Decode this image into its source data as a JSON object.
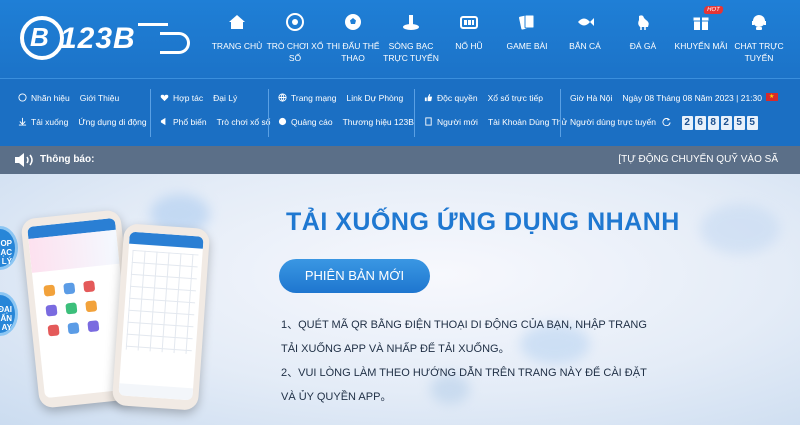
{
  "logo": {
    "text": "123B"
  },
  "nav": [
    {
      "icon": "home-icon",
      "label": "TRANG CHỦ"
    },
    {
      "icon": "lottery-icon",
      "label": "TRÒ CHƠI XỔ SỐ"
    },
    {
      "icon": "soccer-ball-icon",
      "label": "THI ĐẤU THỂ THAO"
    },
    {
      "icon": "casino-icon",
      "label": "SÒNG BẠC TRỰC TUYẾN"
    },
    {
      "icon": "slot-machine-icon",
      "label": "NỔ HŨ"
    },
    {
      "icon": "cards-icon",
      "label": "GAME BÀI"
    },
    {
      "icon": "fish-icon",
      "label": "BẮN CÁ"
    },
    {
      "icon": "rooster-icon",
      "label": "ĐÁ GÀ"
    },
    {
      "icon": "gift-icon",
      "label": "KHUYẾN MÃI",
      "badge": "HOT"
    },
    {
      "icon": "chat-icon",
      "label": "CHAT TRỰC TUYẾN"
    }
  ],
  "info": {
    "brand": "Nhãn hiệu",
    "intro": "Giới Thiệu",
    "download": "Tải xuống",
    "mobile_app": "Ứng dụng di động",
    "cooperation": "Hợp tác",
    "agent": "Đại Lý",
    "popularize": "Phổ biến",
    "lottery_game": "Trò chơi xổ số",
    "website": "Trang mạng",
    "backup_link": "Link Dự Phòng",
    "ads": "Quảng cáo",
    "brand_123b": "Thương hiệu 123B",
    "exclusive": "Độc quyền",
    "live_lottery": "Xổ số trực tiếp",
    "newcomer": "Người mới",
    "trial_account": "Tài Khoản Dùng Thử",
    "time_prefix": "Giờ Hà Nội",
    "datetime": "Ngày 08 Tháng 08 Năm 2023 | 21:30",
    "online_users": "Người dùng trực tuyến",
    "counter": [
      "2",
      "6",
      "8",
      "2",
      "5",
      "5"
    ]
  },
  "notice": {
    "title": "Thông báo:",
    "marquee": "[TỰ ĐỘNG CHUYỂN QUỸ VÀO SÃ"
  },
  "side_tabs": [
    "OP\nẠC\nLÝ",
    "ĐẠI\nẤN\nAY"
  ],
  "hero": {
    "title": "TẢI XUỐNG ỨNG DỤNG NHANH",
    "button": "PHIÊN BẢN MỚI",
    "step1_line1": "1、QUÉT MÃ QR BẰNG ĐIỆN THOẠI DI ĐỘNG CỦA BẠN, NHẬP TRANG",
    "step1_line2": "TẢI XUỐNG APP VÀ NHẤP ĐỂ TẢI XUỐNG。",
    "step2_line1": "2、VUI LÒNG LÀM THEO HƯỚNG DẪN TRÊN TRANG NÀY ĐỂ CÀI ĐẶT",
    "step2_line2": "VÀ ỦY QUYỀN APP。"
  },
  "colors": {
    "header": "#1f7fd6",
    "infobar": "#1b6fc3",
    "notice": "#5b6f88",
    "accent": "#1f78d1"
  }
}
